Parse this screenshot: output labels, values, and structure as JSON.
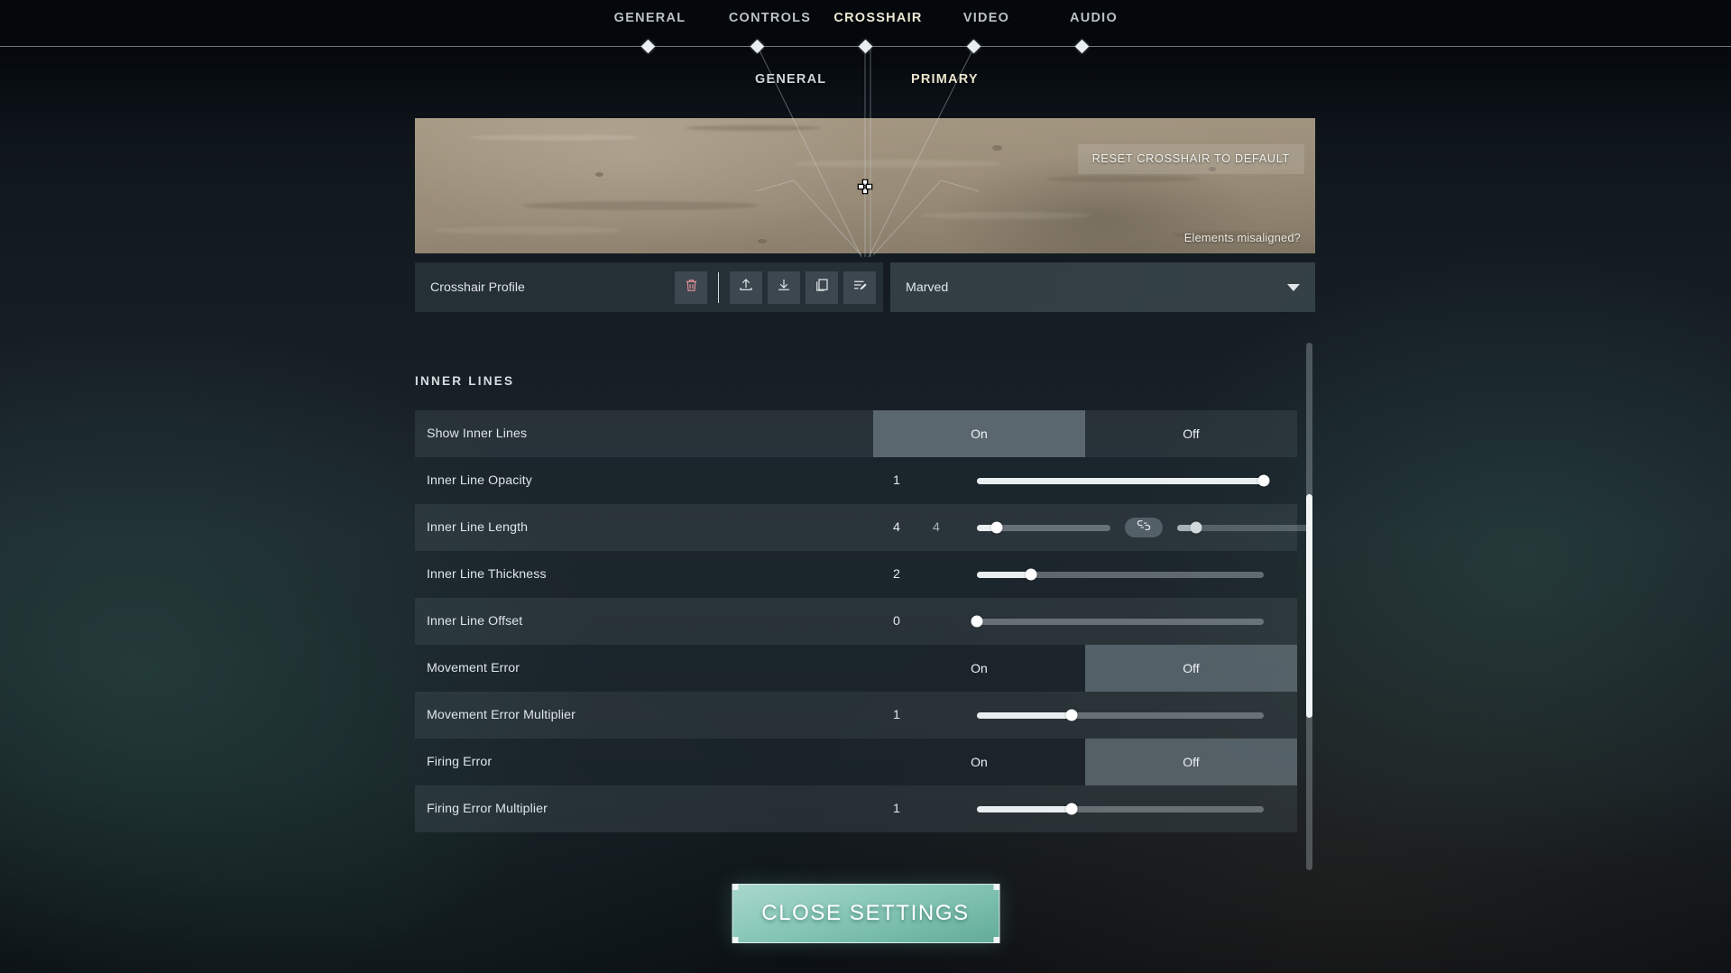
{
  "nav": {
    "tabs": [
      {
        "label": "GENERAL",
        "active": false
      },
      {
        "label": "CONTROLS",
        "active": false
      },
      {
        "label": "CROSSHAIR",
        "active": true
      },
      {
        "label": "VIDEO",
        "active": false
      },
      {
        "label": "AUDIO",
        "active": false
      }
    ]
  },
  "subtabs": [
    {
      "label": "GENERAL",
      "active": false
    },
    {
      "label": "PRIMARY",
      "active": true
    }
  ],
  "preview": {
    "reset_label": "RESET CROSSHAIR TO DEFAULT",
    "misaligned_label": "Elements misaligned?",
    "crosshair_icon": "crosshair-cross"
  },
  "profile": {
    "label": "Crosshair Profile",
    "selected": "Marved",
    "tools": [
      {
        "icon": "trash-icon",
        "name": "delete-profile-button"
      },
      {
        "icon": "upload-icon",
        "name": "import-profile-button"
      },
      {
        "icon": "download-icon",
        "name": "export-profile-button"
      },
      {
        "icon": "copy-icon",
        "name": "duplicate-profile-button"
      },
      {
        "icon": "rename-icon",
        "name": "rename-profile-button"
      }
    ]
  },
  "section": {
    "title": "INNER LINES"
  },
  "rows": [
    {
      "label": "Show Inner Lines",
      "type": "toggle",
      "options": [
        "On",
        "Off"
      ],
      "selected": "On"
    },
    {
      "label": "Inner Line Opacity",
      "type": "slider",
      "value": "1",
      "percent": 100
    },
    {
      "label": "Inner Line Length",
      "type": "dual-slider",
      "value": "4",
      "value2": "4",
      "percent": 15,
      "percent2": 14,
      "link_icon": "link-chain-icon",
      "linked": true
    },
    {
      "label": "Inner Line Thickness",
      "type": "slider",
      "value": "2",
      "percent": 19
    },
    {
      "label": "Inner Line Offset",
      "type": "slider",
      "value": "0",
      "percent": 0
    },
    {
      "label": "Movement Error",
      "type": "toggle",
      "options": [
        "On",
        "Off"
      ],
      "selected": "Off"
    },
    {
      "label": "Movement Error Multiplier",
      "type": "slider",
      "value": "1",
      "percent": 33
    },
    {
      "label": "Firing Error",
      "type": "toggle",
      "options": [
        "On",
        "Off"
      ],
      "selected": "Off"
    },
    {
      "label": "Firing Error Multiplier",
      "type": "slider",
      "value": "1",
      "percent": 33
    }
  ],
  "footer": {
    "close_label": "CLOSE SETTINGS"
  },
  "colors": {
    "accent_teal": "#8ccabb",
    "active_tab": "#ebe6cf",
    "danger": "#e8939b",
    "text": "#dfe5e8"
  }
}
